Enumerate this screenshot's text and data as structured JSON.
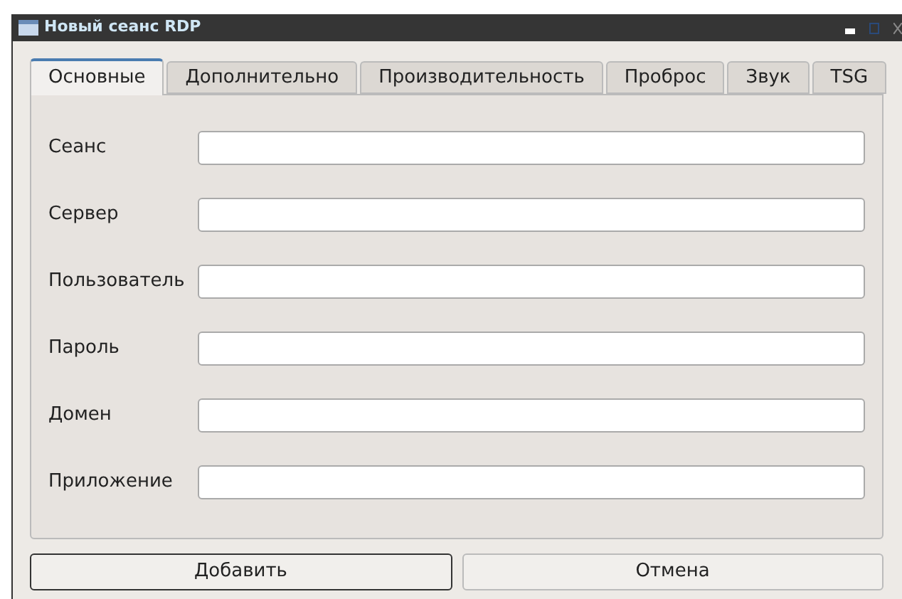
{
  "window": {
    "title": "Новый сеанс RDP"
  },
  "tabs": [
    {
      "label": "Основные",
      "selected": true
    },
    {
      "label": "Дополнительно",
      "selected": false
    },
    {
      "label": "Производительность",
      "selected": false
    },
    {
      "label": "Проброс",
      "selected": false
    },
    {
      "label": "Звук",
      "selected": false
    },
    {
      "label": "TSG",
      "selected": false
    }
  ],
  "fields": [
    {
      "label": "Сеанс"
    },
    {
      "label": "Сервер"
    },
    {
      "label": "Пользователь"
    },
    {
      "label": "Пароль"
    },
    {
      "label": "Домен"
    },
    {
      "label": "Приложение"
    }
  ],
  "buttons": [
    {
      "label": "Добавить",
      "default": true
    },
    {
      "label": "Отмена",
      "default": false
    }
  ]
}
